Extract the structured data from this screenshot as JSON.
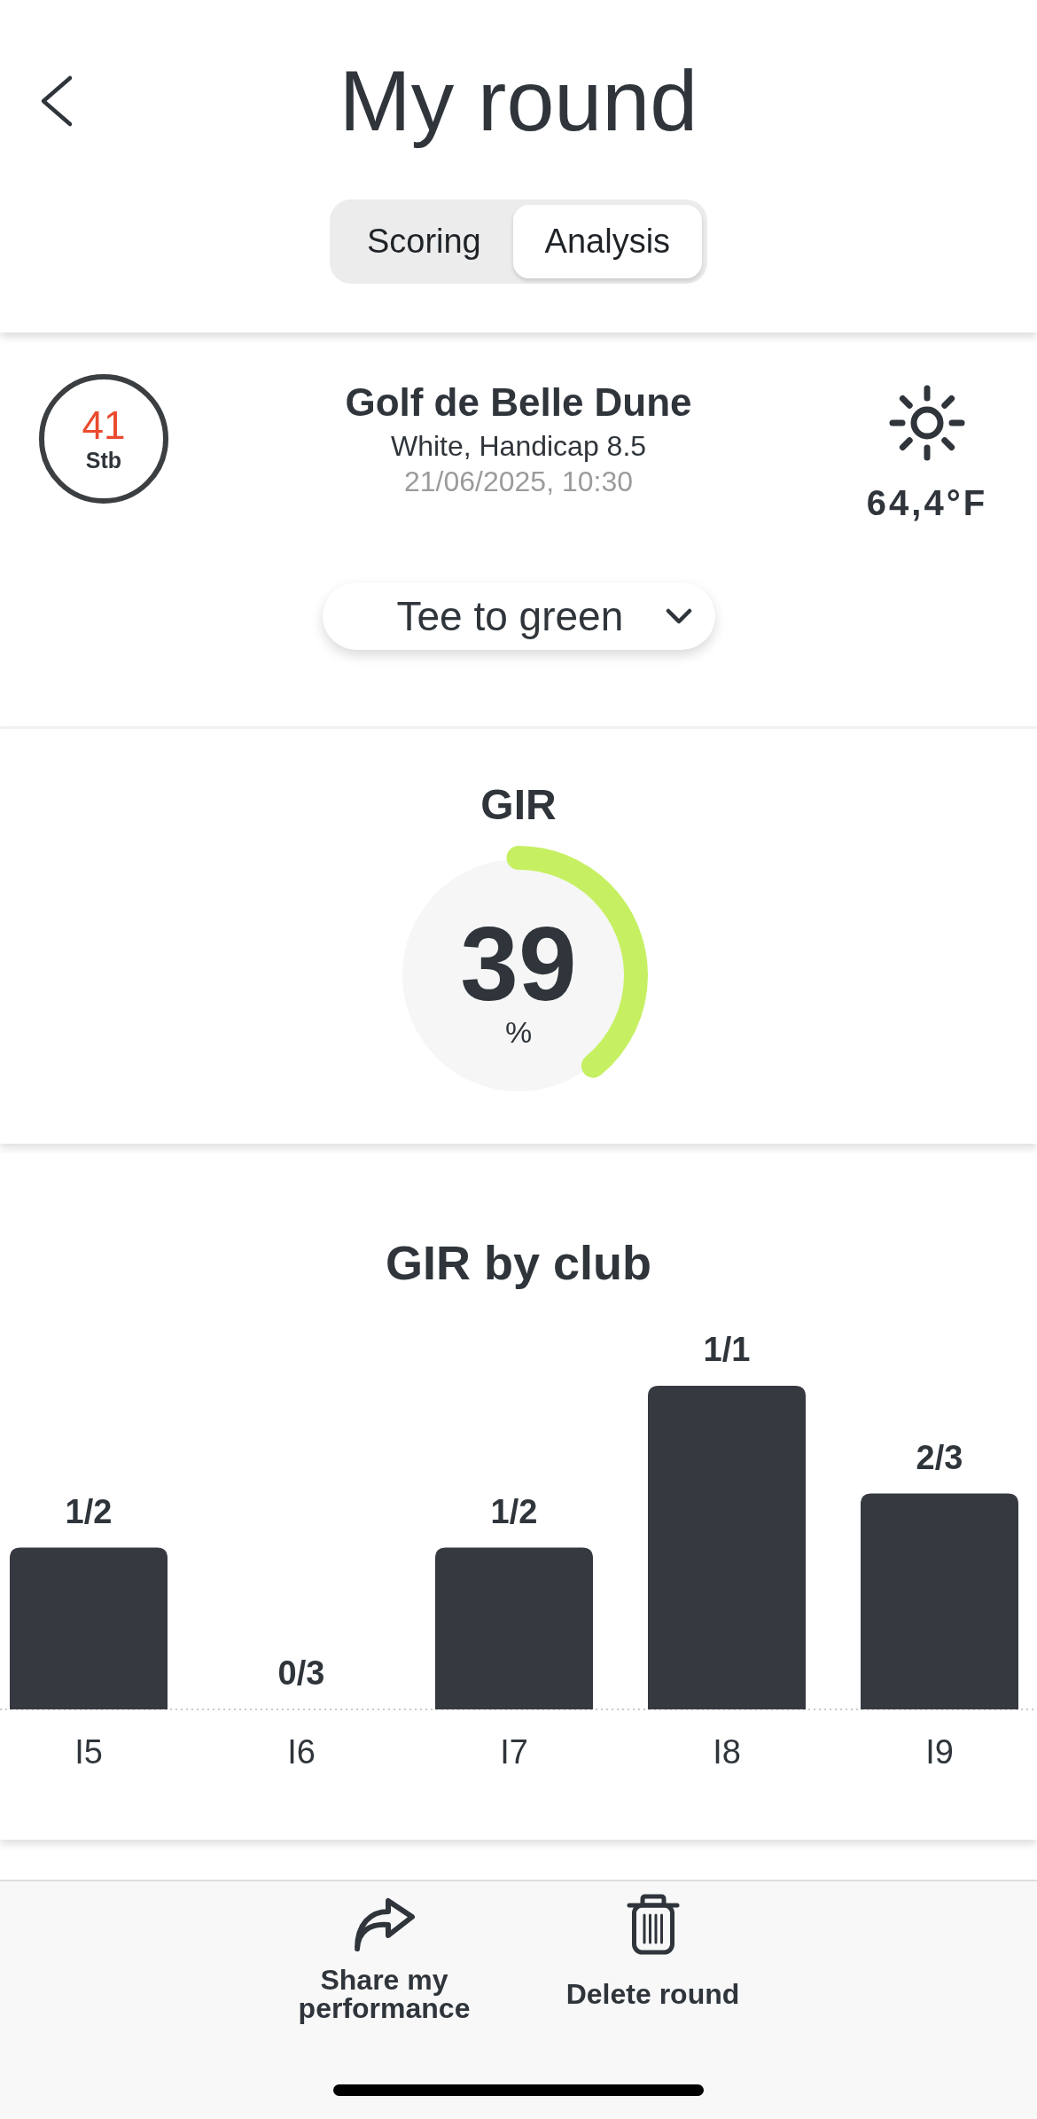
{
  "header": {
    "title": "My round",
    "tabs": [
      {
        "label": "Scoring",
        "selected": false
      },
      {
        "label": "Analysis",
        "selected": true
      }
    ]
  },
  "round": {
    "score": "41",
    "score_unit": "Stb",
    "course": "Golf de Belle Dune",
    "details": "White, Handicap 8.5",
    "date": "21/06/2025, 10:30",
    "temperature": "64,4°F",
    "filter": "Tee to green"
  },
  "gir": {
    "title": "GIR",
    "value": "39",
    "unit": "%",
    "level": 0.39
  },
  "gir_by_club": {
    "chart_data": {
      "type": "bar",
      "title": "GIR by club",
      "categories": [
        "I5",
        "I6",
        "I7",
        "I8",
        "I9"
      ],
      "values": [
        0.5,
        0,
        0.5,
        1,
        0.667
      ],
      "value_labels": [
        "1/2",
        "0/3",
        "1/2",
        "1/1",
        "2/3"
      ]
    }
  },
  "actions": [
    {
      "kind": "share",
      "label": "Share my performance"
    },
    {
      "kind": "delete",
      "label": "Delete round"
    }
  ]
}
